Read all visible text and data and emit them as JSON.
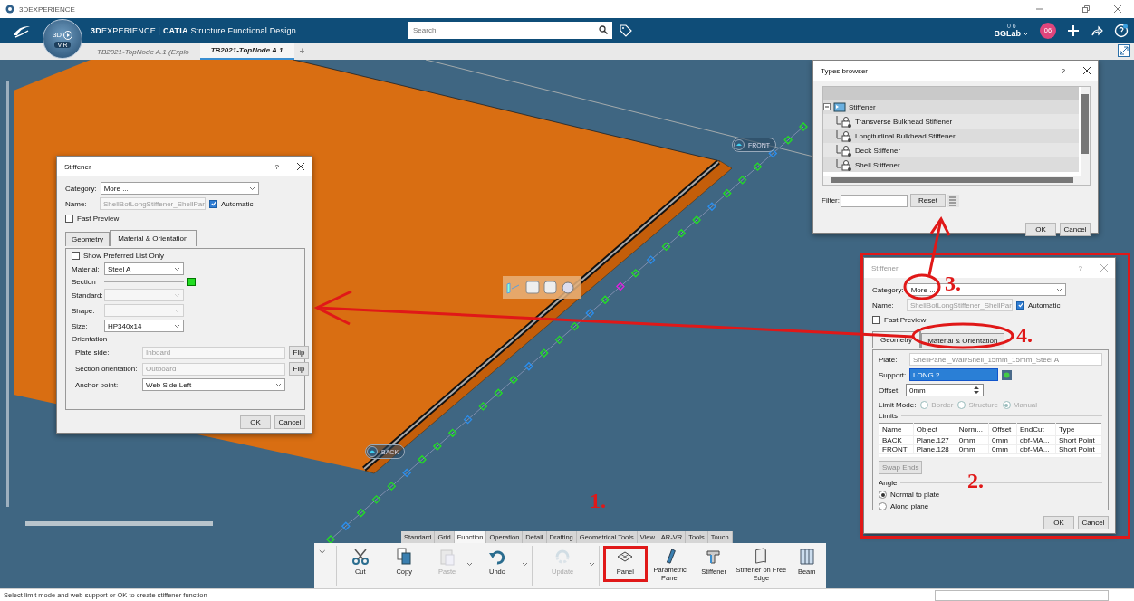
{
  "title_bar": {
    "title": "3DEXPERIENCE"
  },
  "top_bar": {
    "compass_top": "3D",
    "compass_bottom": "V.R",
    "brand": "**3D**EXPERIENCE | **CATIA** Structure Functional Design",
    "search": {
      "placeholder": "Search"
    },
    "user_badge": "0 6",
    "user": "BGLab",
    "avatar": "06"
  },
  "tabs": [
    {
      "label": "TB2021-TopNode A.1 (Explo",
      "selected": false
    },
    {
      "label": "TB2021-TopNode A.1",
      "selected": true
    }
  ],
  "new_tab": "+",
  "viewport": {
    "tags": [
      {
        "text": "FRONT"
      },
      {
        "text": "BACK"
      }
    ]
  },
  "stiffener_dialogs": [
    {
      "title": "Stiffener",
      "active": true,
      "help": "?",
      "category_label": "Category:",
      "category": "More ...",
      "name_label": "Name:",
      "name": "ShellBotLongStiffener_ShellPar",
      "automatic": {
        "label": "Automatic",
        "checked": true
      },
      "fast_preview": {
        "label": "Fast Preview",
        "checked": false
      },
      "tabs": [
        {
          "label": "Geometry",
          "selected": false
        },
        {
          "label": "Material & Orientation",
          "selected": true
        }
      ],
      "panel": {
        "kind": "material",
        "preferred": {
          "label": "Show Preferred List Only",
          "checked": false
        },
        "material_label": "Material:",
        "material": "Steel A",
        "section_label": "Section",
        "standard_label": "Standard:",
        "shape_label": "Shape:",
        "size_label": "Size:",
        "size": "HP340x14",
        "orientation_label": "Orientation",
        "plate_side_label": "Plate side:",
        "plate_side": "Inboard",
        "plate_side_flip": "Flip",
        "section_orientation_label": "Section orientation:",
        "section_orientation": "Outboard",
        "section_flip": "Flip",
        "anchor_label": "Anchor point:",
        "anchor": "Web Side Left"
      },
      "buttons": [
        "OK",
        "Cancel"
      ]
    },
    {
      "title": "Stiffener",
      "active": false,
      "help": "?",
      "category_label": "Category:",
      "category": "More ...",
      "name_label": "Name:",
      "name": "ShellBotLongStiffener_ShellPar",
      "automatic": {
        "label": "Automatic",
        "checked": true
      },
      "fast_preview": {
        "label": "Fast Preview",
        "checked": false
      },
      "tabs": [
        {
          "label": "Geometry",
          "selected": true
        },
        {
          "label": "Material & Orientation",
          "selected": false
        }
      ],
      "panel": {
        "kind": "geometry",
        "plate_label": "Plate:",
        "plate": "ShellPanel_Wall/Shell_15mm_15mm_Steel A",
        "support_label": "Support:",
        "support": "LONG.2",
        "offset_label": "Offset:",
        "offset": "0mm",
        "limit_mode_label": "Limit Mode:",
        "limit_modes_disabled": true,
        "limit_modes": [
          {
            "label": "Border",
            "selected": false
          },
          {
            "label": "Structure",
            "selected": false
          },
          {
            "label": "Manual",
            "selected": true
          }
        ],
        "limits_label": "Limits",
        "columns": [
          "Name",
          "Object",
          "Norm...",
          "Offset",
          "EndCut",
          "Type"
        ],
        "rows": [
          [
            "BACK",
            "Plane.127",
            "0mm",
            "0mm",
            "dbf-MA...",
            "Short Point"
          ],
          [
            "FRONT",
            "Plane.128",
            "0mm",
            "0mm",
            "dbf-MA...",
            "Short Point"
          ]
        ],
        "swap": {
          "label": "Swap Ends",
          "disabled": true
        },
        "angle_label": "Angle",
        "angles": [
          {
            "label": "Normal to plate",
            "selected": true
          },
          {
            "label": "Along plane",
            "selected": false
          }
        ]
      },
      "buttons": [
        "OK",
        "Cancel"
      ]
    }
  ],
  "types_browser": {
    "title": "Types browser",
    "help": "?",
    "tree": [
      {
        "label": "Stiffener",
        "expanded": true,
        "children": [
          {
            "label": "Transverse Bulkhead Stiffener"
          },
          {
            "label": "Longitudinal Bulkhead Stiffener"
          },
          {
            "label": "Deck Stiffener"
          },
          {
            "label": "Shell Stiffener"
          }
        ]
      }
    ],
    "filter_label": "Filter:",
    "reset": "Reset",
    "buttons": [
      "OK",
      "Cancel"
    ]
  },
  "ribbon": {
    "tabs": [
      {
        "label": "Standard",
        "selected": false
      },
      {
        "label": "Grid",
        "selected": false
      },
      {
        "label": "Function",
        "selected": true
      },
      {
        "label": "Operation",
        "selected": false
      },
      {
        "label": "Detail",
        "selected": false
      },
      {
        "label": "Drafting",
        "selected": false
      },
      {
        "label": "Geometrical Tools",
        "selected": false
      },
      {
        "label": "View",
        "selected": false
      },
      {
        "label": "AR-VR",
        "selected": false
      },
      {
        "label": "Tools",
        "selected": false
      },
      {
        "label": "Touch",
        "selected": false
      }
    ],
    "commands": [
      {
        "label": "Cut",
        "disabled": false,
        "dropdown": false,
        "annotated": false
      },
      {
        "label": "Copy",
        "disabled": false,
        "dropdown": false,
        "annotated": false
      },
      {
        "label": "Paste",
        "disabled": true,
        "dropdown": true,
        "annotated": false
      },
      {
        "label": "Undo",
        "disabled": false,
        "dropdown": true,
        "annotated": false
      },
      {
        "label": "Update",
        "disabled": true,
        "dropdown": true,
        "annotated": false
      },
      {
        "label": "Panel",
        "disabled": false,
        "dropdown": false,
        "annotated": true
      },
      {
        "label": "Parametric Panel",
        "disabled": false,
        "dropdown": false,
        "annotated": false
      },
      {
        "label": "Stiffener",
        "disabled": false,
        "dropdown": false,
        "annotated": false
      },
      {
        "label": "Stiffener on Free Edge",
        "disabled": false,
        "dropdown": false,
        "annotated": false
      },
      {
        "label": "Beam",
        "disabled": false,
        "dropdown": false,
        "annotated": false
      }
    ]
  },
  "annotations": [
    {
      "text": "1."
    },
    {
      "text": "2."
    },
    {
      "text": "3."
    },
    {
      "text": "4."
    }
  ],
  "status_bar": {
    "message": "Select limit mode and web support or OK to create stiffener function"
  }
}
